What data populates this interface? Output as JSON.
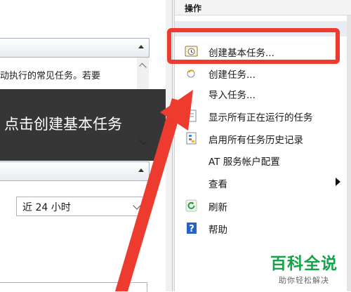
{
  "left_pane": {
    "description_text": "动执行的常见任务。若要",
    "time_filter": {
      "selected": "近 24 小时"
    }
  },
  "caption": {
    "text": "点击创建基本任务"
  },
  "actions_pane": {
    "header": "操作",
    "items": [
      {
        "label": "创建基本任务...",
        "icon": "calendar-task-icon"
      },
      {
        "label": "创建任务...",
        "icon": "task-icon"
      },
      {
        "label": "导入任务...",
        "icon": ""
      },
      {
        "label": "显示所有正在运行的任务",
        "icon": "list-icon"
      },
      {
        "label": "启用所有任务历史记录",
        "icon": "history-icon"
      },
      {
        "label": "AT 服务帐户配置",
        "icon": ""
      },
      {
        "label": "查看",
        "icon": "",
        "submenu": true
      },
      {
        "label": "刷新",
        "icon": "refresh-icon"
      },
      {
        "label": "帮助",
        "icon": "help-icon"
      }
    ]
  },
  "watermark": {
    "title": "百科全说",
    "subtitle": "助你轻松解决"
  },
  "colors": {
    "highlight": "#ee3b2f",
    "watermark_green": "#17a34a",
    "help_blue": "#2563c9"
  }
}
